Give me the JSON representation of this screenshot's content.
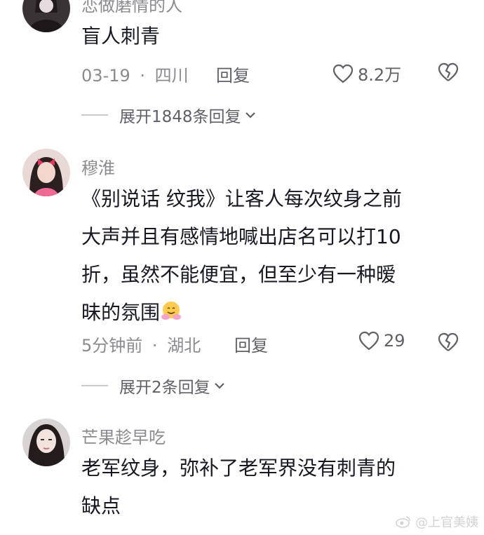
{
  "comments": [
    {
      "username": "恋做磨情的人",
      "lines": [
        "盲人刺青"
      ],
      "time": "03-19",
      "location": "四川",
      "reply_label": "回复",
      "likes": "8.2万",
      "expand_label": "展开1848条回复"
    },
    {
      "username": "穆淮",
      "lines": [
        "《别说话 纹我》让客人每次纹身之前",
        "大声并且有感情地喊出店名可以打10",
        "折，虽然不能便宜，但至少有一种暧",
        "昧的氛围"
      ],
      "emoji": "hugging-face",
      "time": "5分钟前",
      "location": "湖北",
      "reply_label": "回复",
      "likes": "29",
      "expand_label": "展开2条回复"
    },
    {
      "username": "芒果趁早吃",
      "lines": [
        "老军纹身，弥补了老军界没有刺青的",
        "缺点"
      ]
    }
  ],
  "separator": "·",
  "watermark": "@上官美姨",
  "colors": {
    "text": "#161823",
    "secondary": "#8a8b91",
    "action": "#5f6068"
  }
}
